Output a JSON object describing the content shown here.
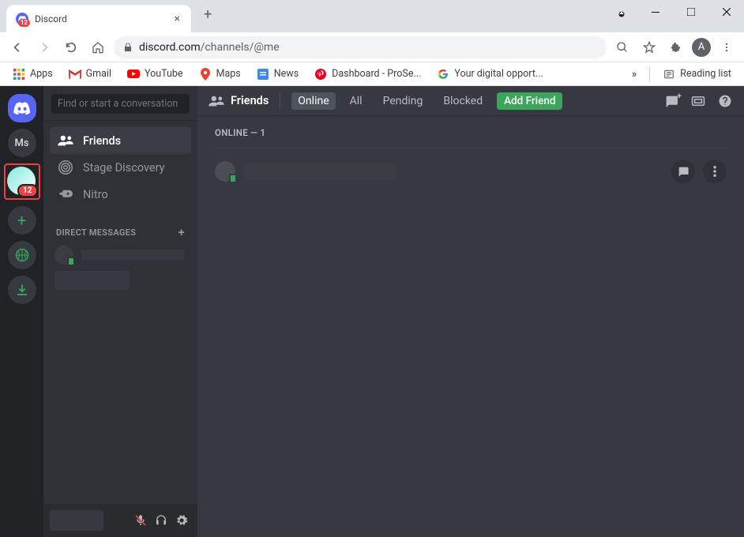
{
  "browser": {
    "tab_title": "Discord",
    "favicon_badge": "12",
    "url": {
      "domain": "discord.com",
      "path": "/channels/@me"
    },
    "avatar_letter": "A",
    "bookmarks": [
      {
        "label": "Apps",
        "icon": "apps"
      },
      {
        "label": "Gmail",
        "icon": "gmail"
      },
      {
        "label": "YouTube",
        "icon": "youtube"
      },
      {
        "label": "Maps",
        "icon": "maps"
      },
      {
        "label": "News",
        "icon": "news"
      },
      {
        "label": "Dashboard - ProSe...",
        "icon": "pinterest"
      },
      {
        "label": "Your digital opport...",
        "icon": "google"
      }
    ],
    "reading_list": "Reading list"
  },
  "discord": {
    "servers": {
      "ms_label": "Ms",
      "highlighted_badge": "12"
    },
    "sidebar": {
      "search_placeholder": "Find or start a conversation",
      "nav": [
        {
          "label": "Friends",
          "active": true
        },
        {
          "label": "Stage Discovery",
          "active": false
        },
        {
          "label": "Nitro",
          "active": false
        }
      ],
      "dm_header": "DIRECT MESSAGES"
    },
    "topbar": {
      "title": "Friends",
      "tabs": [
        {
          "label": "Online",
          "active": true
        },
        {
          "label": "All",
          "active": false
        },
        {
          "label": "Pending",
          "active": false
        },
        {
          "label": "Blocked",
          "active": false
        }
      ],
      "add_friend": "Add Friend"
    },
    "content": {
      "section_header": "ONLINE — 1"
    }
  }
}
